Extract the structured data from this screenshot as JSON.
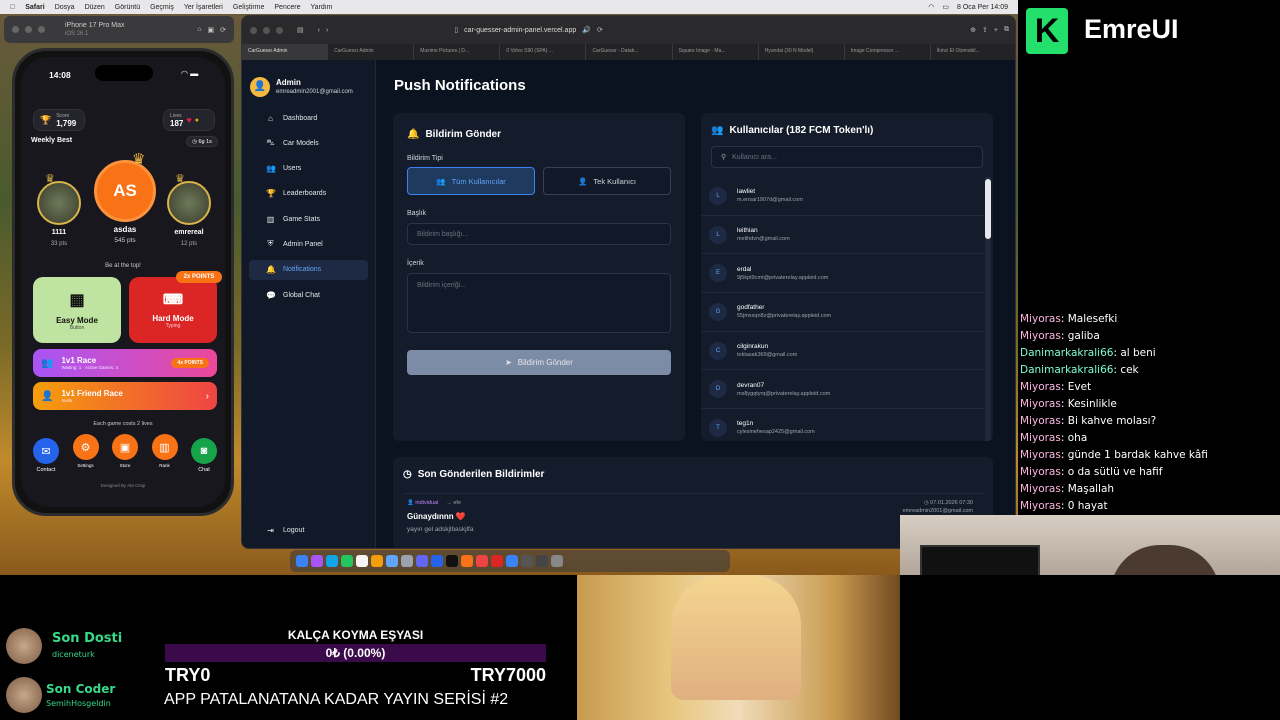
{
  "menubar": {
    "items": [
      "Safari",
      "Dosya",
      "Düzen",
      "Görüntü",
      "Geçmiş",
      "Yer İşaretleri",
      "Geliştirme",
      "Pencere",
      "Yardım"
    ],
    "datetime": "8 Oca Per 14:09"
  },
  "simulator": {
    "device": "iPhone 17 Pro Max",
    "os": "iOS 26.1"
  },
  "phone": {
    "time": "14:08",
    "score_label": "Score",
    "score": "1,799",
    "lives_label": "Lives",
    "lives": "187",
    "weekly_best": "Weekly Best",
    "timer": "6g 1s",
    "podium": [
      {
        "name": "1111",
        "pts": "33 pts"
      },
      {
        "name": "asdas",
        "initials": "AS",
        "pts": "545 pts"
      },
      {
        "name": "emrereal",
        "pts": "12 pts"
      }
    ],
    "be_at_top": "Be at the top!",
    "easy_mode": "Easy Mode",
    "easy_sub": "Button",
    "hard_mode": "Hard Mode",
    "hard_sub": "Typing",
    "double_badge": "2x POINTS",
    "race": "1v1 Race",
    "race_sub": "Waiting: 1  ·  Active Games: 4",
    "race_badge": "4x POINTS",
    "friend_race": "1v1 Friend Race",
    "friend_sub": "Invite",
    "costs": "Each game costs 2 lives",
    "bottom_nav": [
      "Contact",
      "Settings",
      "Store",
      "Rank",
      "Chat"
    ],
    "footer": "Designed By Ata Ciraji"
  },
  "browser": {
    "url": "car-guesser-admin-panel.vercel.app",
    "tabs": [
      "CarGuessr Admin",
      "CarGuessr Admin",
      "Maxime Pictures | D...",
      "0 Volvo S90 (SPA) ...",
      "CarGuessr - Datab...",
      "Square Image - Ma...",
      "Hyundai (30 N Model)",
      "Image Compressor ...",
      "İkinci El Otomobil..."
    ]
  },
  "admin": {
    "name": "Admin",
    "email": "emreadmin2001@gmail.com"
  },
  "nav": [
    {
      "label": "Dashboard",
      "icon": "dashboard-icon"
    },
    {
      "label": "Car Models",
      "icon": "car-icon"
    },
    {
      "label": "Users",
      "icon": "users-icon"
    },
    {
      "label": "Leaderboards",
      "icon": "trophy-icon"
    },
    {
      "label": "Game Stats",
      "icon": "stats-icon"
    },
    {
      "label": "Admin Panel",
      "icon": "shield-icon"
    },
    {
      "label": "Notifications",
      "icon": "bell-icon"
    },
    {
      "label": "Global Chat",
      "icon": "chat-icon"
    }
  ],
  "logout": "Logout",
  "page_title": "Push Notifications",
  "send_card": {
    "title": "Bildirim Gönder",
    "type_label": "Bildirim Tipi",
    "all_users": "Tüm Kullanıcılar",
    "single_user": "Tek Kullanıcı",
    "title_label": "Başlık",
    "title_placeholder": "Bildirim başlığı...",
    "content_label": "İçerik",
    "content_placeholder": "Bildirim içeriği...",
    "send_button": "Bildirim Gönder"
  },
  "users_card": {
    "title": "Kullanıcılar (182 FCM Token'lı)",
    "search_placeholder": "Kullanıcı ara...",
    "users": [
      {
        "initial": "L",
        "name": "lawliet",
        "email": "m.ensar1907d@gmail.com"
      },
      {
        "initial": "L",
        "name": "leithian",
        "email": "melihdvn@gmail.com"
      },
      {
        "initial": "E",
        "name": "erdal",
        "email": "9j5kpt9cmt@privaterelay.appleid.com"
      },
      {
        "initial": "G",
        "name": "godfather",
        "email": "55jmxsqn8z@privaterelay.appleid.com"
      },
      {
        "initial": "C",
        "name": "cilginrakun",
        "email": "toktasak369@gmail.com"
      },
      {
        "initial": "D",
        "name": "devran07",
        "email": "ms8ygqtyrq@privaterelay.appleid.com"
      },
      {
        "initial": "T",
        "name": "teg1n",
        "email": "cylesinehesap2425@gmail.com"
      }
    ]
  },
  "recent": {
    "title": "Son Gönderilen Bildirimler",
    "items": [
      {
        "type": "individual",
        "target": "→ efe",
        "date": "07.01.2026 07:30",
        "sender": "emreadmin2001@gmail.com",
        "title": "Günaydınnn ❤️",
        "body": "yayın gel adskjlbaskjlfa"
      }
    ]
  },
  "brand": "EmreUI",
  "chat": [
    {
      "user": "Miyoras",
      "msg": "Malesefki"
    },
    {
      "user": "Miyoras",
      "msg": "galiba"
    },
    {
      "user": "Danimarkakrali66",
      "msg": "al beni"
    },
    {
      "user": "Danimarkakrali66",
      "msg": "cek"
    },
    {
      "user": "Miyoras",
      "msg": "Evet"
    },
    {
      "user": "Miyoras",
      "msg": "Kesinlikle"
    },
    {
      "user": "Miyoras",
      "msg": "Bi kahve molası?"
    },
    {
      "user": "Miyoras",
      "msg": "oha"
    },
    {
      "user": "Miyoras",
      "msg": "günde 1 bardak kahve kâfi"
    },
    {
      "user": "Miyoras",
      "msg": "o da sütlü ve hafif"
    },
    {
      "user": "Miyoras",
      "msg": "Maşallah"
    },
    {
      "user": "Miyoras",
      "msg": "0 hayat"
    }
  ],
  "stream": {
    "last_donor_label": "Son Dosti",
    "last_donor": "diceneturk",
    "last_coder_label": "Son Coder",
    "last_coder": "SemihHosgeldin",
    "goal_title": "KALÇA KOYMA EŞYASI",
    "goal_progress": "0₺ (0.00%)",
    "goal_fraction": 0,
    "goal_min": "TRY0",
    "goal_max": "TRY7000",
    "series": "APP PATALANATANA KADAR YAYIN SERİSİ #2"
  }
}
